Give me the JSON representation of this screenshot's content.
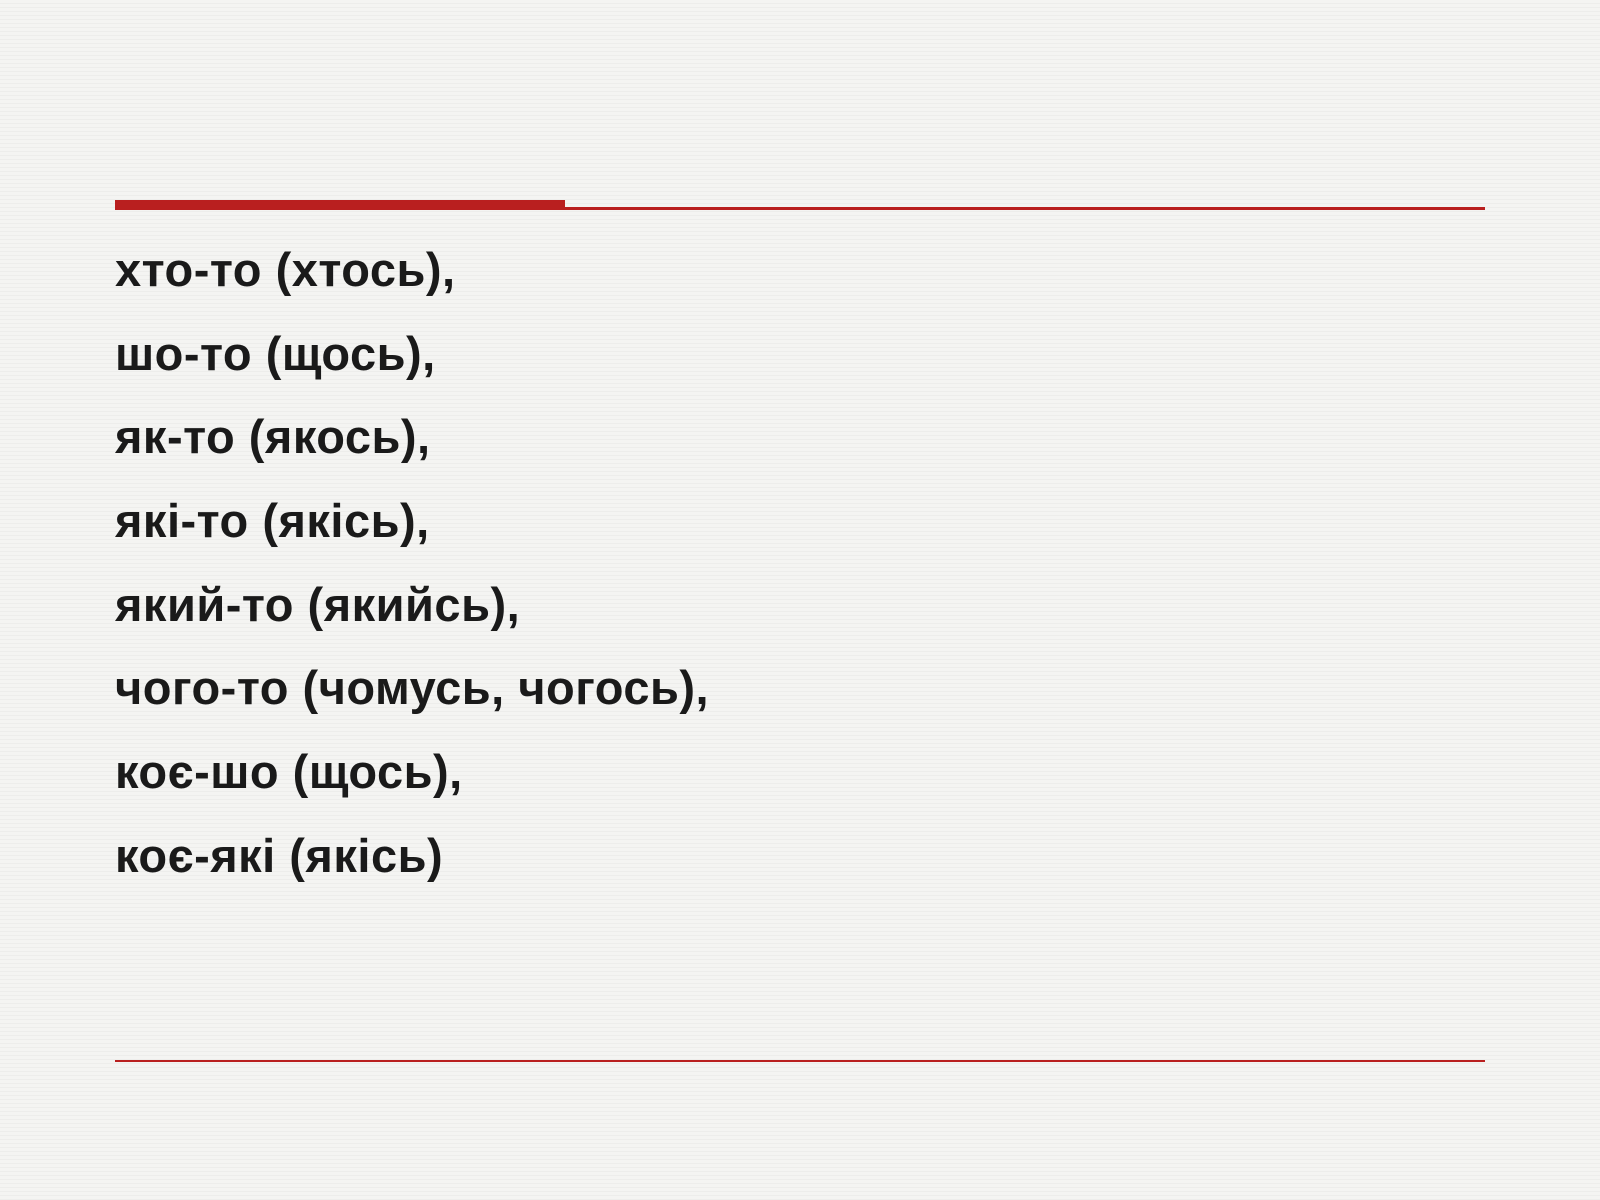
{
  "lines": [
    "хто-то (хтось),",
    "шо-то (щось),",
    "як-то (якось),",
    "які-то (якісь),",
    "який-то (якийсь),",
    "чого-то (чомусь, чогось),",
    "коє-шо (щось),",
    "коє-які (якісь)"
  ],
  "colors": {
    "accent": "#b91f1f",
    "text": "#1a1a1a",
    "background": "#f4f4f2"
  }
}
